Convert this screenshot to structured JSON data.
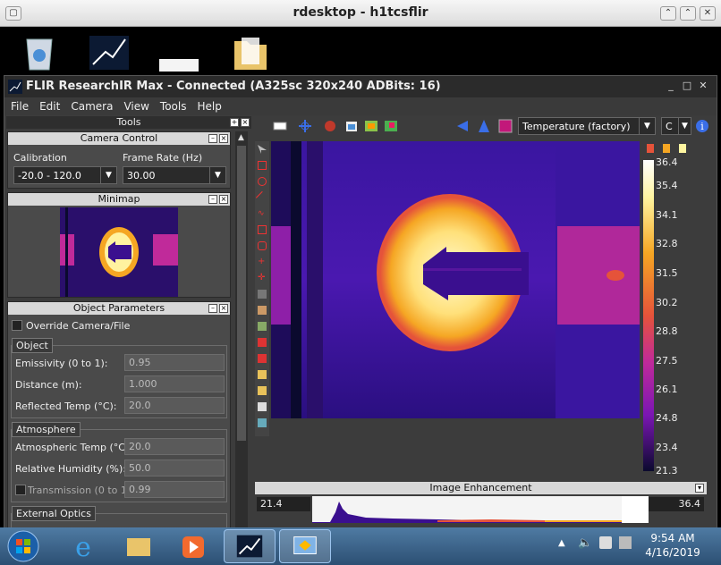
{
  "rdesktop": {
    "title": "rdesktop - h1tcsflir"
  },
  "app": {
    "title": "FLIR ResearchIR Max - Connected (A325sc 320x240 ADBits: 16)",
    "menu": [
      "File",
      "Edit",
      "Camera",
      "View",
      "Tools",
      "Help"
    ]
  },
  "tools": {
    "header": "Tools",
    "camera_control": {
      "title": "Camera Control",
      "calibration_label": "Calibration",
      "calibration_value": "-20.0 - 120.0",
      "frame_rate_label": "Frame Rate (Hz)",
      "frame_rate_value": "30.00"
    },
    "minimap": {
      "title": "Minimap"
    },
    "object_parameters": {
      "title": "Object Parameters",
      "override_label": "Override Camera/File",
      "object_group": "Object",
      "emissivity_label": "Emissivity (0 to 1):",
      "emissivity_value": "0.95",
      "distance_label": "Distance (m):",
      "distance_value": "1.000",
      "reflected_label": "Reflected Temp (°C):",
      "reflected_value": "20.0",
      "atmosphere_group": "Atmosphere",
      "atm_temp_label": "Atmospheric Temp (°C):",
      "atm_temp_value": "20.0",
      "humidity_label": "Relative Humidity (%):",
      "humidity_value": "50.0",
      "transmission_label": "Transmission (0 to 1):",
      "transmission_value": "0.99",
      "external_optics_group": "External Optics"
    }
  },
  "viewer": {
    "units_dropdown": "Temperature (factory)",
    "unit": "C",
    "colorbar_ticks": [
      "36.4",
      "35.4",
      "34.1",
      "32.8",
      "31.5",
      "30.2",
      "28.8",
      "27.5",
      "26.1",
      "24.8",
      "23.4",
      "21.3"
    ],
    "image_enhancement": {
      "title": "Image Enhancement",
      "min": "21.4",
      "max": "36.4"
    }
  },
  "taskbar": {
    "time": "9:54 AM",
    "date": "4/16/2019"
  },
  "colors": {
    "palette": [
      "#0b0a2e",
      "#3a0f8f",
      "#7a16b3",
      "#c02a9a",
      "#e5533a",
      "#f5a623",
      "#fff5a0",
      "#ffffff"
    ]
  }
}
